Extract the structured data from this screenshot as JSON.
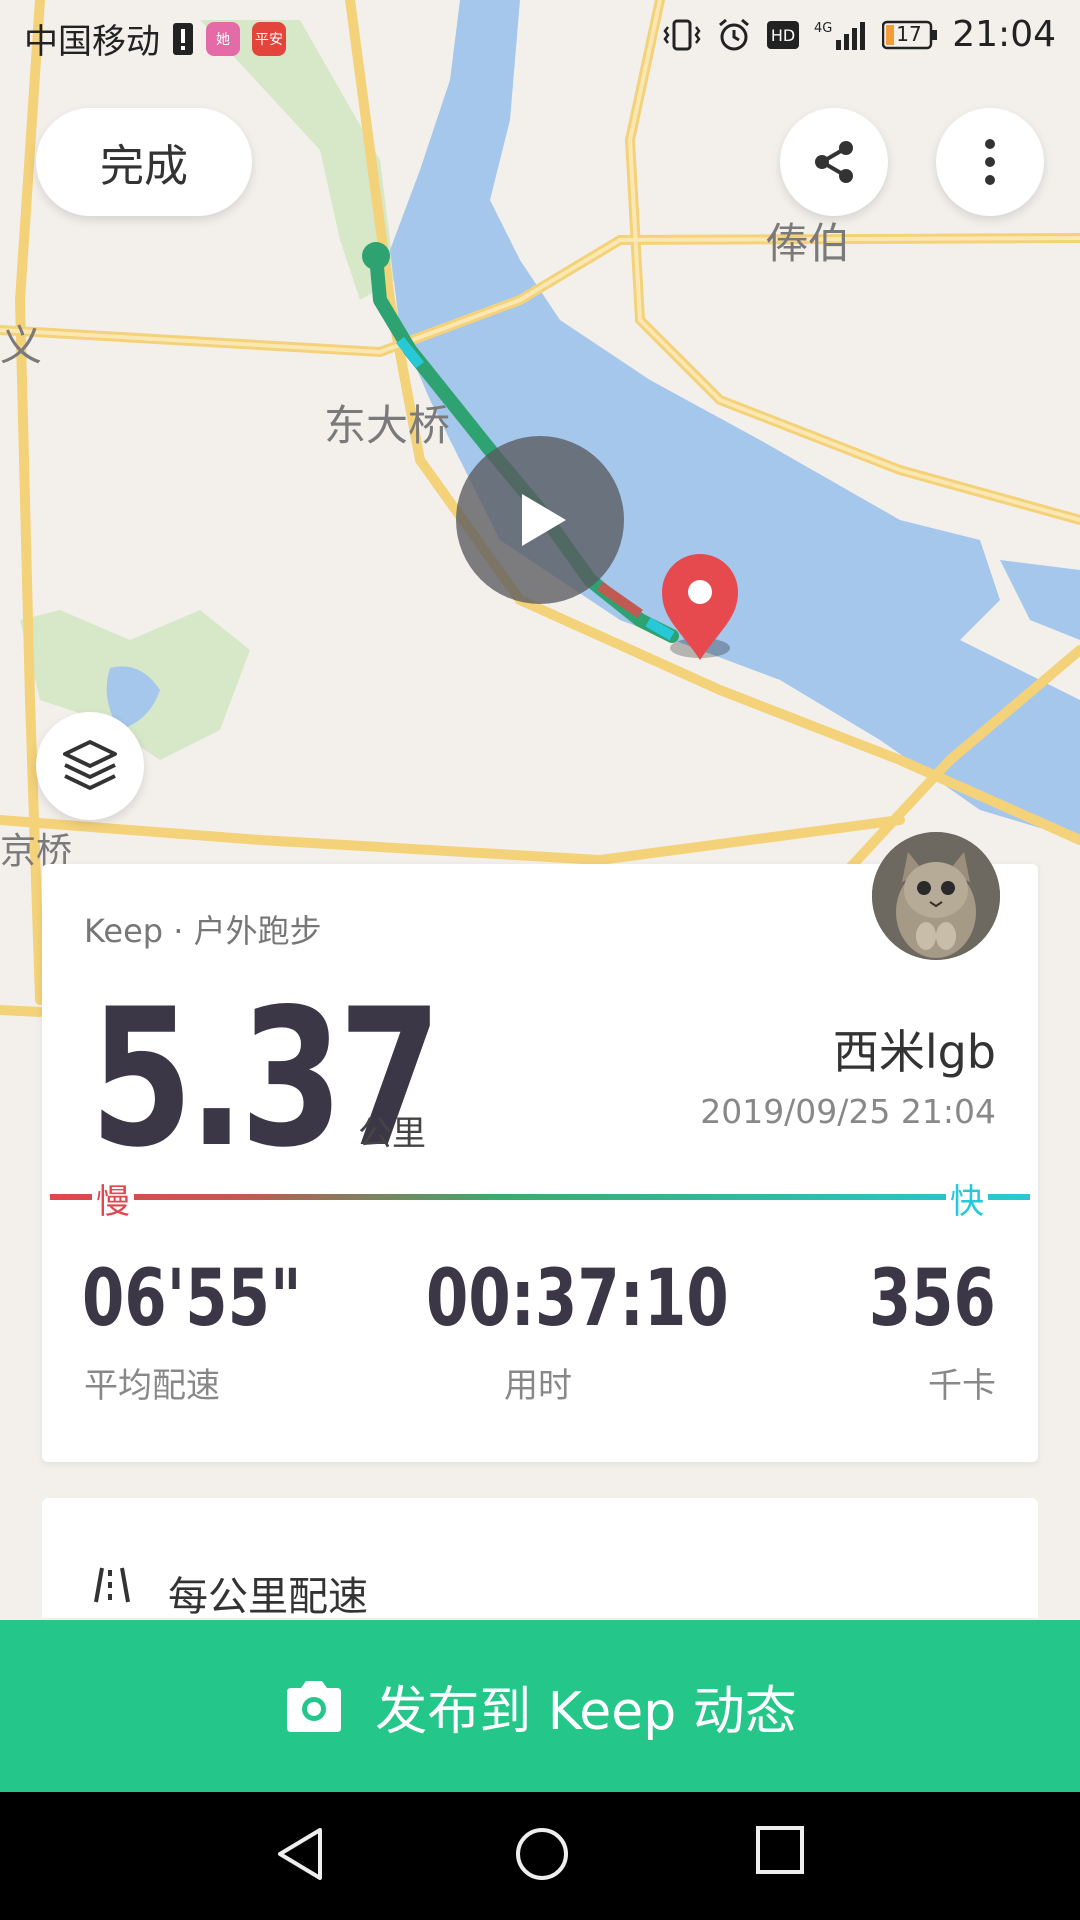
{
  "status_bar": {
    "carrier": "中国移动",
    "badge1": "她",
    "badge2": "平安",
    "time": "21:04",
    "battery": "17",
    "network": "4G"
  },
  "top_actions": {
    "done_label": "完成"
  },
  "map": {
    "labels": {
      "fengbo": "俸伯",
      "dongdaqiao": "东大桥",
      "yi": "义",
      "jingqiao": "京桥"
    },
    "icons": [
      "share-icon",
      "more-vertical-icon",
      "layers-icon",
      "play-icon",
      "location-pin-icon"
    ]
  },
  "summary_card": {
    "source": "Keep · 户外跑步",
    "distance": "5.37",
    "distance_unit": "公里",
    "username": "西米lgb",
    "datetime": "2019/09/25 21:04",
    "pace_scale": {
      "slow": "慢",
      "fast": "快"
    },
    "stats": [
      {
        "value": "06'55\"",
        "label": "平均配速"
      },
      {
        "value": "00:37:10",
        "label": "用时"
      },
      {
        "value": "356",
        "label": "千卡"
      }
    ]
  },
  "pace_section": {
    "title": "每公里配速"
  },
  "publish": {
    "label": "发布到 Keep 动态"
  },
  "colors": {
    "accent_green": "#24c789",
    "slow_red": "#e0474c",
    "fast_cyan": "#27c9d8",
    "river_blue": "#a5c7ec"
  }
}
